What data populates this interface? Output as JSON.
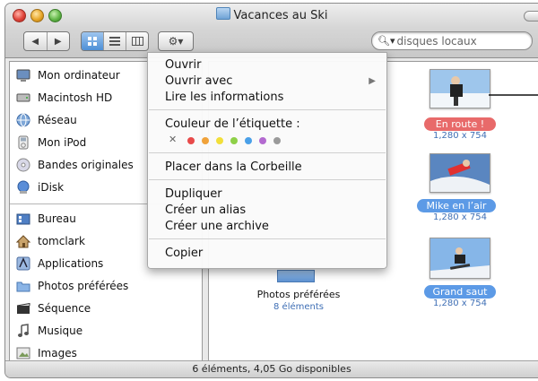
{
  "window": {
    "title": "Vacances au Ski",
    "search_placeholder": "disques locaux",
    "status": "6 éléments, 4,05 Go disponibles"
  },
  "toolbar": {
    "back_icon": "back-arrow-icon",
    "forward_icon": "forward-arrow-icon",
    "views": [
      "icon-view",
      "list-view",
      "column-view"
    ],
    "action_icon": "gear-icon"
  },
  "sidebar": {
    "devices": [
      {
        "label": "Mon ordinateur",
        "icon": "computer-icon"
      },
      {
        "label": "Macintosh HD",
        "icon": "hard-drive-icon"
      },
      {
        "label": "Réseau",
        "icon": "network-icon"
      },
      {
        "label": "Mon iPod",
        "icon": "ipod-icon"
      },
      {
        "label": "Bandes originales",
        "icon": "cd-icon"
      },
      {
        "label": "iDisk",
        "icon": "idisk-icon"
      }
    ],
    "places": [
      {
        "label": "Bureau",
        "icon": "desktop-icon"
      },
      {
        "label": "tomclark",
        "icon": "home-icon"
      },
      {
        "label": "Applications",
        "icon": "applications-icon"
      },
      {
        "label": "Photos préférées",
        "icon": "folder-icon"
      },
      {
        "label": "Séquence",
        "icon": "movie-icon"
      },
      {
        "label": "Musique",
        "icon": "music-icon"
      },
      {
        "label": "Images",
        "icon": "pictures-icon"
      }
    ]
  },
  "menu": {
    "items": [
      {
        "label": "Ouvrir"
      },
      {
        "label": "Ouvrir avec",
        "submenu": true
      },
      {
        "label": "Lire les informations"
      },
      {
        "label": "Couleur de l’étiquette :"
      },
      {
        "label": "Placer dans la Corbeille"
      },
      {
        "label": "Dupliquer"
      },
      {
        "label": "Créer un alias"
      },
      {
        "label": "Créer une archive"
      },
      {
        "label": "Copier"
      }
    ],
    "label_colors": [
      "#e84a4a",
      "#f0a23a",
      "#f2df3a",
      "#8ed048",
      "#4aa0e8",
      "#b36ad0",
      "#9a9a9a"
    ]
  },
  "files": [
    {
      "label": "En route !",
      "dims": "1,280 x 754",
      "label_color": "#e86a6a"
    },
    {
      "label": "Mike en  l’air",
      "dims": "1,280 x 754",
      "label_color": "#5c9ae6"
    },
    {
      "label": "Grand saut",
      "dims": "1,280 x 754",
      "label_color": "#5c9ae6"
    }
  ],
  "folder": {
    "label": "Photos préférées",
    "count": "8 éléments"
  }
}
